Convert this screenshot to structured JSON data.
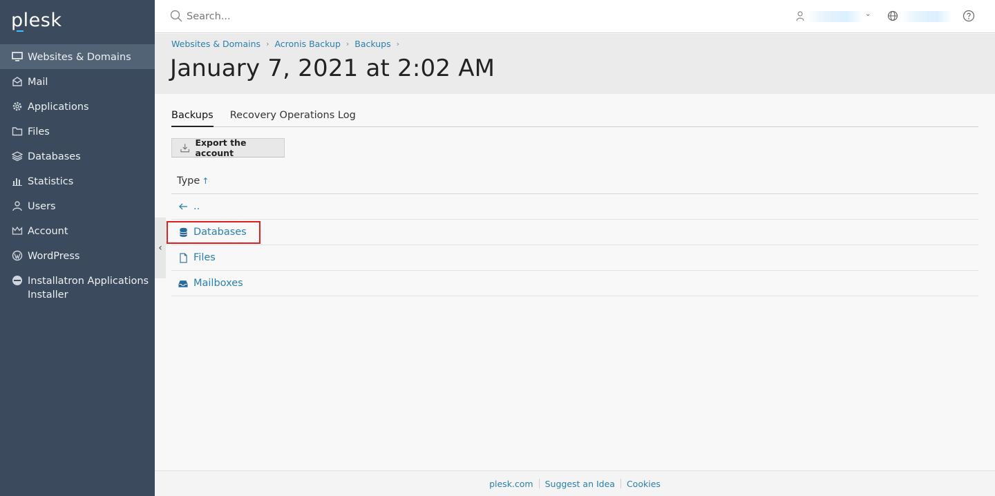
{
  "brand": {
    "logo_text": "plesk",
    "accent_color": "#3cc2ff"
  },
  "sidebar": {
    "background": "#3b4a5c",
    "items": [
      {
        "label": "Websites & Domains",
        "icon": "monitor-icon",
        "active": true
      },
      {
        "label": "Mail",
        "icon": "envelope-icon"
      },
      {
        "label": "Applications",
        "icon": "gear-icon"
      },
      {
        "label": "Files",
        "icon": "folder-icon"
      },
      {
        "label": "Databases",
        "icon": "layers-icon"
      },
      {
        "label": "Statistics",
        "icon": "bar-chart-icon"
      },
      {
        "label": "Users",
        "icon": "user-icon"
      },
      {
        "label": "Account",
        "icon": "crown-icon"
      },
      {
        "label": "WordPress",
        "icon": "wordpress-icon"
      },
      {
        "label": "Installatron Applications Installer",
        "icon": "installatron-icon"
      }
    ]
  },
  "topbar": {
    "search_placeholder": "Search...",
    "icons": [
      "search-icon",
      "user-icon",
      "chevron-down-icon",
      "globe-icon",
      "help-icon"
    ]
  },
  "breadcrumb": [
    "Websites & Domains",
    "Acronis Backup",
    "Backups"
  ],
  "page_title": "January 7, 2021 at 2:02 AM",
  "tabs": [
    {
      "label": "Backups",
      "active": true
    },
    {
      "label": "Recovery Operations Log",
      "active": false
    }
  ],
  "toolbar": {
    "export_label": "Export the account"
  },
  "list": {
    "header": "Type",
    "sort_indicator": "↑",
    "rows": [
      {
        "label": "..",
        "icon": "arrow-left-icon"
      },
      {
        "label": "Databases",
        "icon": "database-icon",
        "highlighted": true
      },
      {
        "label": "Files",
        "icon": "file-icon"
      },
      {
        "label": "Mailboxes",
        "icon": "inbox-icon"
      }
    ]
  },
  "collapse_glyph": "‹",
  "footer": {
    "links": [
      "plesk.com",
      "Suggest an Idea",
      "Cookies"
    ]
  },
  "colors": {
    "link": "#2a7fae",
    "highlight_border": "#e02020"
  }
}
